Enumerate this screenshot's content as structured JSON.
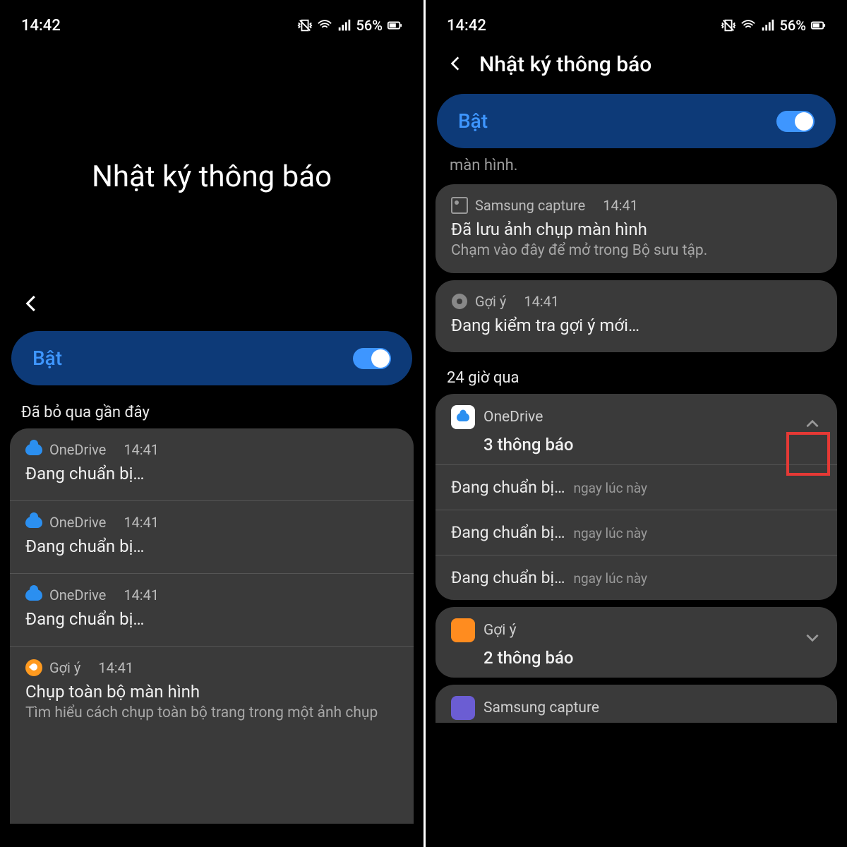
{
  "status": {
    "time": "14:42",
    "battery": "56%"
  },
  "left": {
    "title": "Nhật ký thông báo",
    "toggle_label": "Bật",
    "section": "Đã bỏ qua gần đây",
    "items": [
      {
        "app": "OneDrive",
        "time": "14:41",
        "title": "Đang chuẩn bị…"
      },
      {
        "app": "OneDrive",
        "time": "14:41",
        "title": "Đang chuẩn bị…"
      },
      {
        "app": "OneDrive",
        "time": "14:41",
        "title": "Đang chuẩn bị…"
      },
      {
        "app": "Gợi ý",
        "time": "14:41",
        "title": "Chụp toàn bộ màn hình",
        "sub": "Tìm hiểu cách chụp toàn bộ trang trong một ảnh chụp"
      }
    ]
  },
  "right": {
    "header": "Nhật ký thông báo",
    "toggle_label": "Bật",
    "partial": "màn hình.",
    "cards": [
      {
        "app": "Samsung capture",
        "time": "14:41",
        "title": "Đã lưu ảnh chụp màn hình",
        "sub": "Chạm vào đây để mở trong Bộ sưu tập."
      },
      {
        "app": "Gợi ý",
        "time": "14:41",
        "title": "Đang kiểm tra gợi ý mới…"
      }
    ],
    "section": "24 giờ qua",
    "group1": {
      "app": "OneDrive",
      "count": "3 thông báo",
      "lines": [
        {
          "t": "Đang chuẩn bị…",
          "s": "ngay lúc này"
        },
        {
          "t": "Đang chuẩn bị…",
          "s": "ngay lúc này"
        },
        {
          "t": "Đang chuẩn bị…",
          "s": "ngay lúc này"
        }
      ]
    },
    "group2": {
      "app": "Gợi ý",
      "count": "2 thông báo"
    },
    "group3": {
      "app": "Samsung capture"
    }
  }
}
